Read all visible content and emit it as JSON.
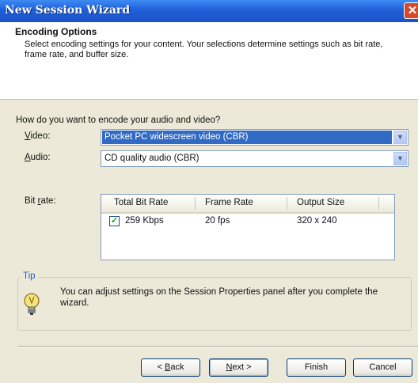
{
  "window": {
    "title": "New Session Wizard",
    "close_glyph": "✕"
  },
  "header": {
    "title": "Encoding Options",
    "description": "Select encoding settings for your content. Your selections determine settings such as bit rate, frame rate, and buffer size."
  },
  "question": "How do you want to encode your audio and video?",
  "video": {
    "label_u": "V",
    "label_rest": "ideo:",
    "value": "Pocket PC widescreen video (CBR)"
  },
  "audio": {
    "label_u": "A",
    "label_rest": "udio:",
    "value": "CD quality audio (CBR)"
  },
  "bitrate": {
    "label_pre": "Bit ",
    "label_u": "r",
    "label_rest": "ate:",
    "columns": [
      "Total Bit Rate",
      "Frame Rate",
      "Output Size"
    ],
    "rows": [
      {
        "checked": true,
        "total": "259 Kbps",
        "frame": "20 fps",
        "size": "320 x 240"
      }
    ]
  },
  "tip": {
    "label": "Tip",
    "icon": "lightbulb-icon",
    "text": "You can adjust settings on the Session Properties panel after you complete the wizard."
  },
  "buttons": {
    "back_pre": "< ",
    "back_u": "B",
    "back_rest": "ack",
    "next_u": "N",
    "next_rest": "ext >",
    "finish": "Finish",
    "cancel": "Cancel"
  },
  "colors": {
    "title_bar": "#1f5fd8",
    "selection": "#316ac5",
    "tip_label": "#1d5bd8"
  }
}
